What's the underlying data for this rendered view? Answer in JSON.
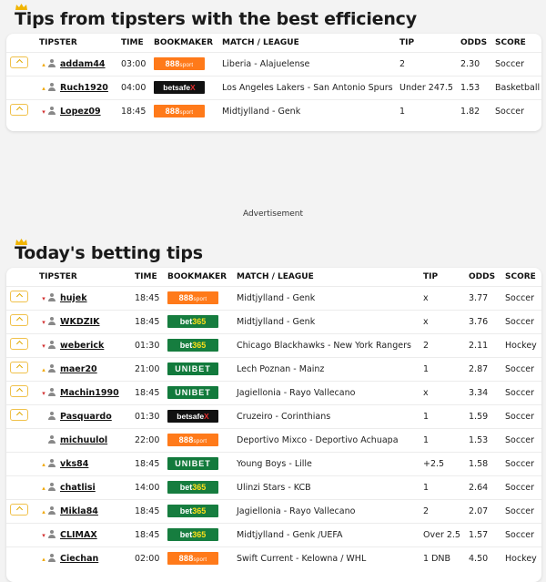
{
  "top_section": {
    "title": "Tips from tipsters with the best efficiency",
    "headers": [
      "TIPSTER",
      "TIME",
      "BOOKMAKER",
      "MATCH / LEAGUE",
      "TIP",
      "ODDS",
      "SCORE"
    ],
    "rows": [
      {
        "fav": true,
        "trend": "up",
        "tipster": "addam44",
        "time": "03:00",
        "bookmaker": "888sport",
        "match": "Liberia - Alajuelense",
        "tip": "2",
        "odds": "2.30",
        "score": "Soccer"
      },
      {
        "fav": false,
        "trend": "up",
        "tipster": "Ruch1920",
        "time": "04:00",
        "bookmaker": "betsafe",
        "match": "Los Angeles Lakers - San Antonio Spurs",
        "tip": "Under 247.5",
        "odds": "1.53",
        "score": "Basketball"
      },
      {
        "fav": true,
        "trend": "down",
        "tipster": "Lopez09",
        "time": "18:45",
        "bookmaker": "888sport",
        "match": "Midtjylland - Genk",
        "tip": "1",
        "odds": "1.82",
        "score": "Soccer"
      }
    ]
  },
  "advertisement_label": "Advertisement",
  "today_section": {
    "title": "Today's betting tips",
    "headers": [
      "TIPSTER",
      "TIME",
      "BOOKMAKER",
      "MATCH / LEAGUE",
      "TIP",
      "ODDS",
      "SCORE"
    ],
    "rows": [
      {
        "fav": true,
        "trend": "down",
        "tipster": "hujek",
        "time": "18:45",
        "bookmaker": "888sport",
        "match": "Midtjylland - Genk",
        "tip": "x",
        "odds": "3.77",
        "score": "Soccer"
      },
      {
        "fav": true,
        "trend": "down",
        "tipster": "WKDZIK",
        "time": "18:45",
        "bookmaker": "bet365",
        "match": "Midtjylland - Genk",
        "tip": "x",
        "odds": "3.76",
        "score": "Soccer"
      },
      {
        "fav": true,
        "trend": "down",
        "tipster": "weberick",
        "time": "01:30",
        "bookmaker": "bet365",
        "match": "Chicago Blackhawks - New York Rangers",
        "tip": "2",
        "odds": "2.11",
        "score": "Hockey"
      },
      {
        "fav": true,
        "trend": "up",
        "tipster": "maer20",
        "time": "21:00",
        "bookmaker": "unibet",
        "match": "Lech Poznan - Mainz",
        "tip": "1",
        "odds": "2.87",
        "score": "Soccer"
      },
      {
        "fav": true,
        "trend": "down",
        "tipster": "Machin1990",
        "time": "18:45",
        "bookmaker": "unibet",
        "match": "Jagiellonia - Rayo Vallecano",
        "tip": "x",
        "odds": "3.34",
        "score": "Soccer"
      },
      {
        "fav": true,
        "trend": "none",
        "tipster": "Pasquardo",
        "time": "01:30",
        "bookmaker": "betsafe",
        "match": "Cruzeiro - Corinthians",
        "tip": "1",
        "odds": "1.59",
        "score": "Soccer"
      },
      {
        "fav": false,
        "trend": "none",
        "tipster": "michuulol",
        "time": "22:00",
        "bookmaker": "888sport",
        "match": "Deportivo Mixco - Deportivo Achuapa",
        "tip": "1",
        "odds": "1.53",
        "score": "Soccer"
      },
      {
        "fav": false,
        "trend": "up",
        "tipster": "vks84",
        "time": "18:45",
        "bookmaker": "unibet",
        "match": "Young Boys - Lille",
        "tip": "+2.5",
        "odds": "1.58",
        "score": "Soccer"
      },
      {
        "fav": false,
        "trend": "up",
        "tipster": "chatlisi",
        "time": "14:00",
        "bookmaker": "bet365",
        "match": "Ulinzi Stars - KCB",
        "tip": "1",
        "odds": "2.64",
        "score": "Soccer"
      },
      {
        "fav": true,
        "trend": "up",
        "tipster": "Mikla84",
        "time": "18:45",
        "bookmaker": "bet365",
        "match": "Jagiellonia - Rayo Vallecano",
        "tip": "2",
        "odds": "2.07",
        "score": "Soccer"
      },
      {
        "fav": false,
        "trend": "down",
        "tipster": "CLIMAX",
        "time": "18:45",
        "bookmaker": "bet365",
        "match": "Midtjylland - Genk /UEFA",
        "tip": "Over 2.5",
        "odds": "1.57",
        "score": "Soccer"
      },
      {
        "fav": false,
        "trend": "up",
        "tipster": "Ciechan",
        "time": "02:00",
        "bookmaker": "888sport",
        "match": "Swift Current - Kelowna / WHL",
        "tip": "1 DNB",
        "odds": "4.50",
        "score": "Hockey"
      }
    ]
  },
  "colors": {
    "accent": "#f0a500",
    "down": "#d32f2f",
    "bet365": "#167d3f",
    "888sport": "#ff7a1a"
  }
}
